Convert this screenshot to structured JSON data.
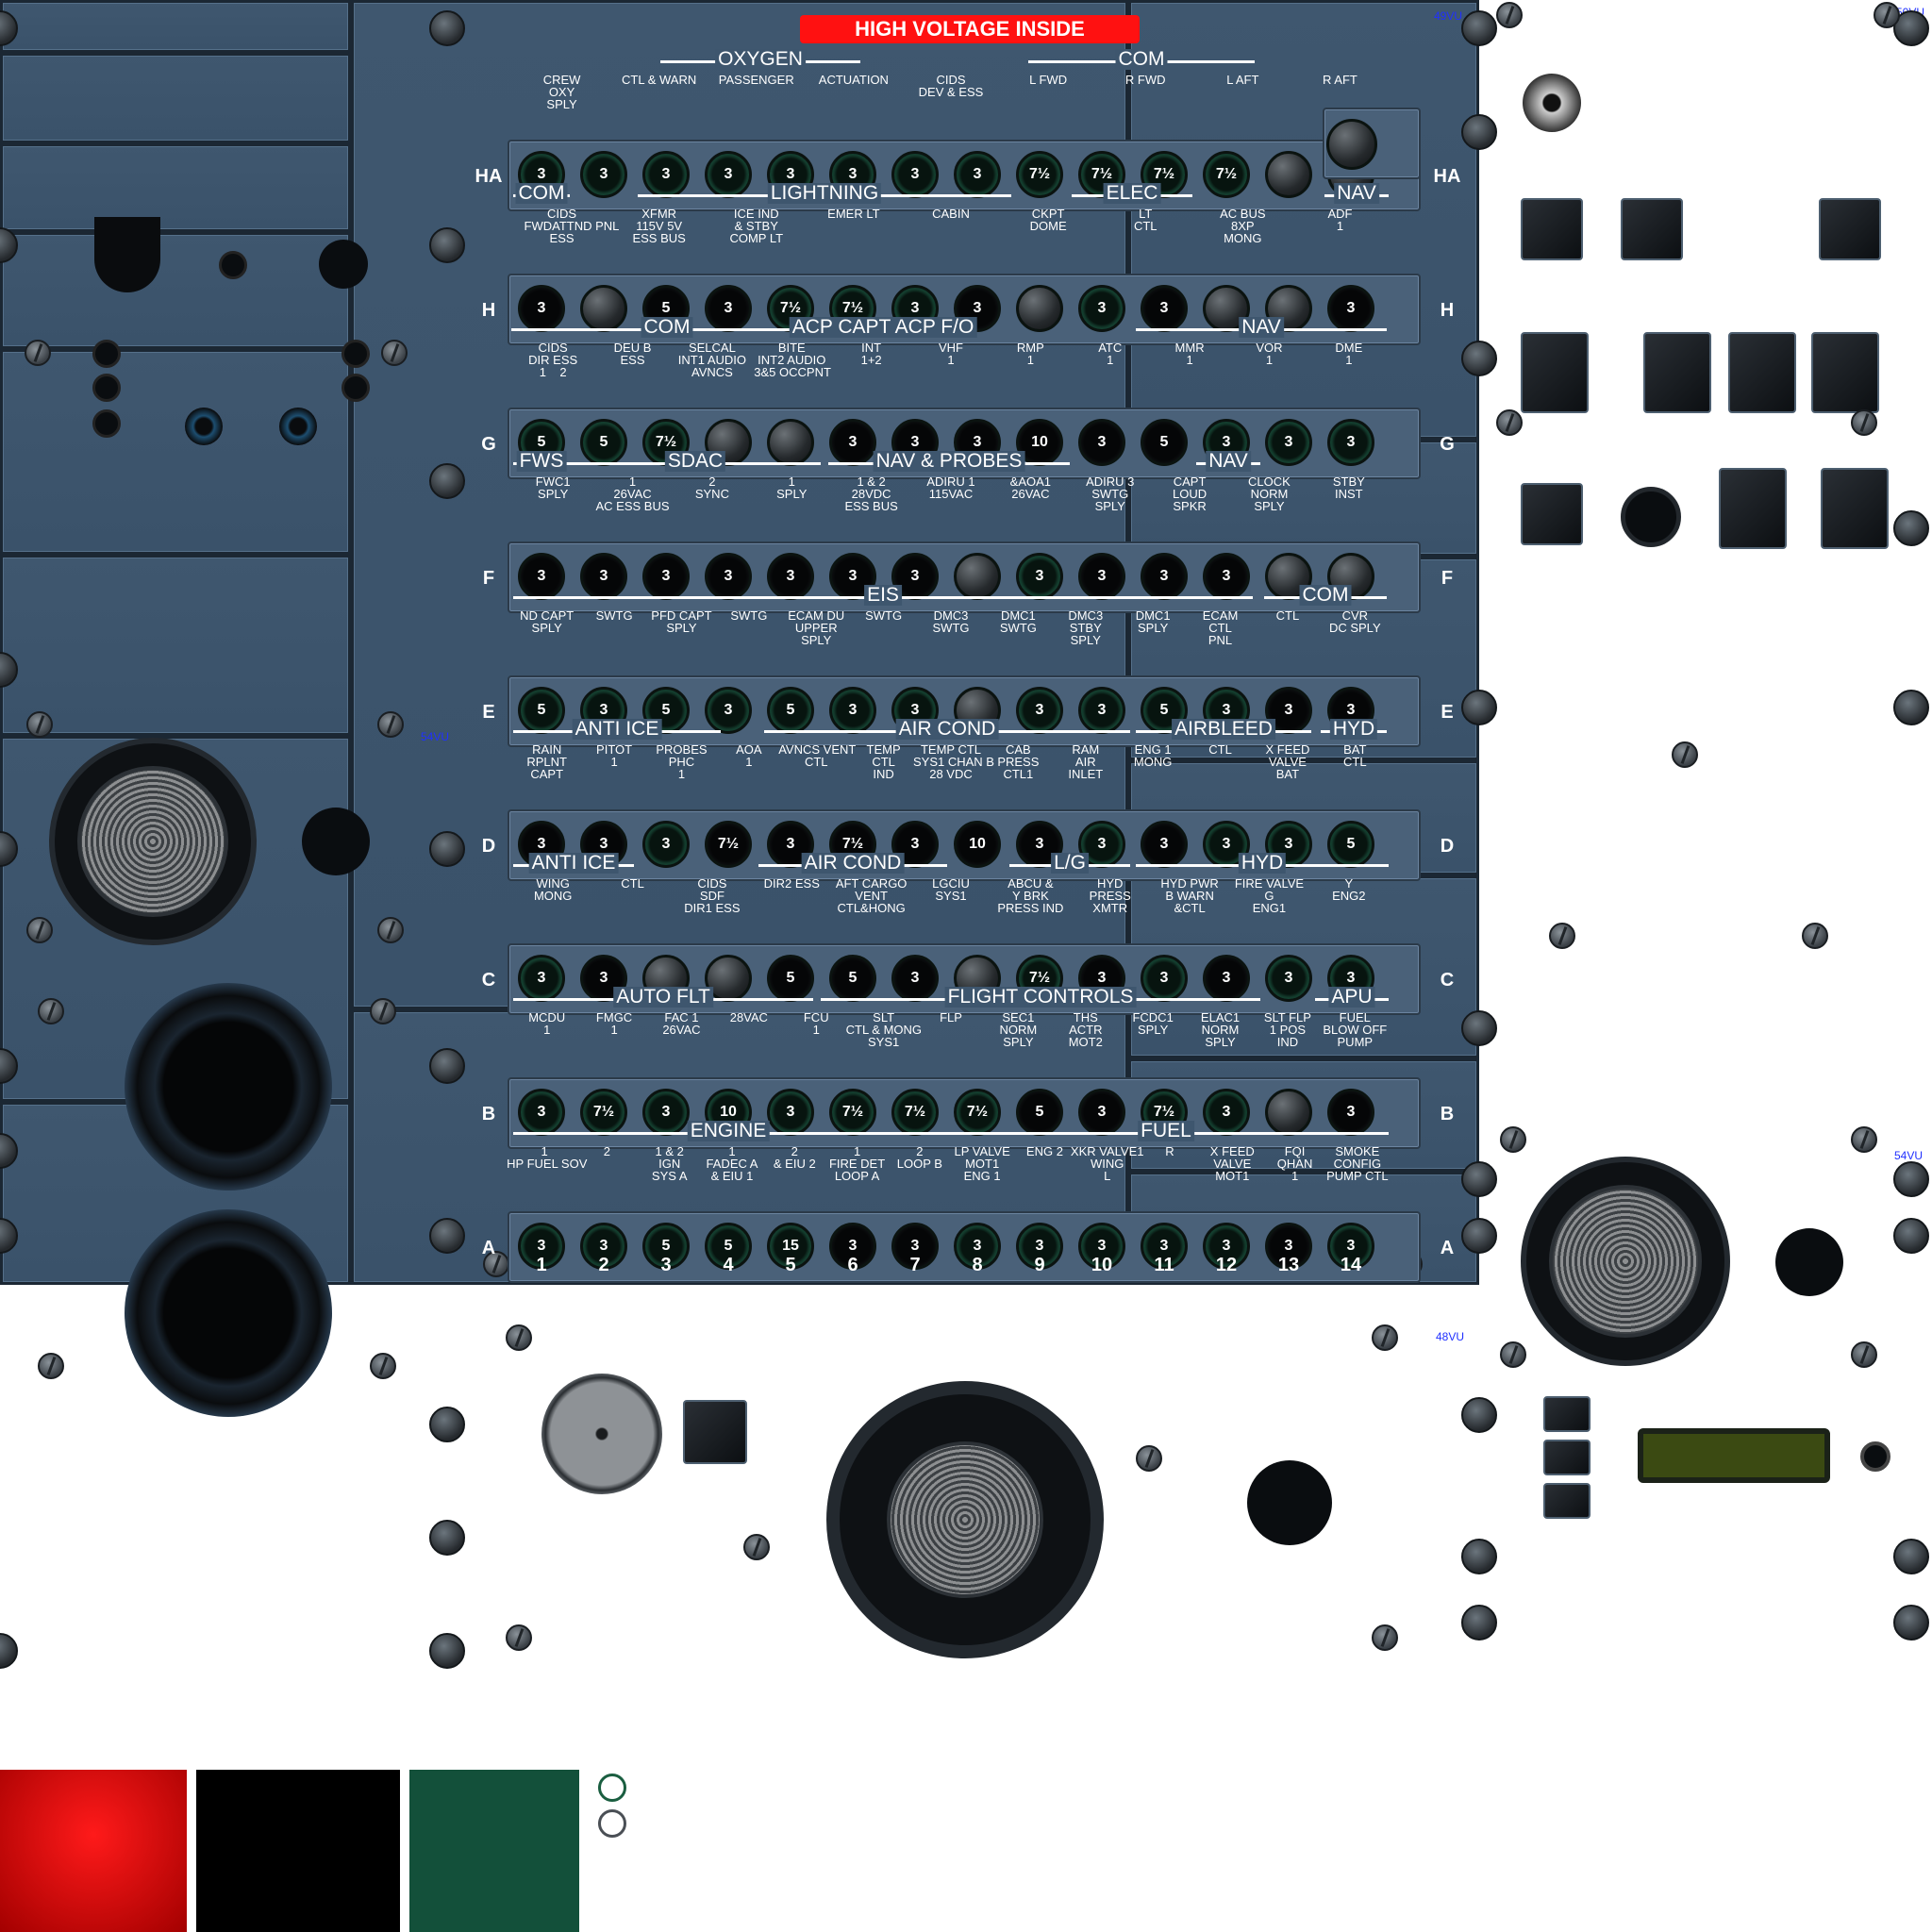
{
  "header": {
    "warning_label": "HIGH VOLTAGE INSIDE",
    "vu_top": "49VU",
    "vu_right": "50VU",
    "vu_left": "54VU",
    "vu_right2": "54VU",
    "vu_bottom": "48VU"
  },
  "rows": [
    "HA",
    "H",
    "G",
    "F",
    "E",
    "D",
    "C",
    "B",
    "A"
  ],
  "columns": [
    "1",
    "2",
    "3",
    "4",
    "5",
    "6",
    "7",
    "8",
    "9",
    "10",
    "11",
    "12",
    "13",
    "14"
  ],
  "breakers": {
    "HA": [
      "3",
      "3",
      "3",
      "3",
      "3",
      "3",
      "3",
      "3",
      "7½",
      "7½",
      "7½",
      "7½",
      "",
      ""
    ],
    "H": [
      "3",
      "",
      "5",
      "3",
      "7½",
      "7½",
      "3",
      "3",
      "",
      "3",
      "3",
      "",
      "",
      "3"
    ],
    "G": [
      "5",
      "5",
      "7½",
      "",
      "",
      "3",
      "3",
      "3",
      "10",
      "3",
      "5",
      "3",
      "3",
      "3"
    ],
    "F": [
      "3",
      "3",
      "3",
      "3",
      "3",
      "3",
      "3",
      "",
      "3",
      "3",
      "3",
      "3",
      "",
      ""
    ],
    "E": [
      "5",
      "3",
      "5",
      "3",
      "5",
      "3",
      "3",
      "",
      "3",
      "3",
      "5",
      "3",
      "3",
      "3"
    ],
    "D": [
      "3",
      "3",
      "3",
      "7½",
      "3",
      "7½",
      "3",
      "10",
      "3",
      "3",
      "3",
      "3",
      "3",
      "5"
    ],
    "C": [
      "3",
      "3",
      "",
      "",
      "5",
      "5",
      "3",
      "",
      "7½",
      "3",
      "3",
      "3",
      "3",
      "3"
    ],
    "B": [
      "3",
      "7½",
      "3",
      "10",
      "3",
      "7½",
      "7½",
      "7½",
      "5",
      "3",
      "7½",
      "3",
      "",
      "3"
    ],
    "A": [
      "3",
      "3",
      "5",
      "5",
      "15",
      "3",
      "3",
      "3",
      "3",
      "3",
      "3",
      "3",
      "3",
      "3"
    ]
  },
  "groups": [
    {
      "text": "OXYGEN",
      "row": "HA"
    },
    {
      "text": "COM",
      "row": "HA"
    },
    {
      "text": "COM",
      "row": "H"
    },
    {
      "text": "LIGHTNING",
      "row": "H"
    },
    {
      "text": "ELEC",
      "row": "H"
    },
    {
      "text": "NAV",
      "row": "H"
    },
    {
      "text": "COM",
      "row": "G"
    },
    {
      "text": "ACP CAPT ACP F/O",
      "row": "G"
    },
    {
      "text": "NAV",
      "row": "G"
    },
    {
      "text": "FWS",
      "row": "F"
    },
    {
      "text": "SDAC",
      "row": "F"
    },
    {
      "text": "NAV & PROBES",
      "row": "F"
    },
    {
      "text": "NAV",
      "row": "F"
    },
    {
      "text": "EIS",
      "row": "E"
    },
    {
      "text": "COM",
      "row": "E"
    },
    {
      "text": "ANTI ICE",
      "row": "D"
    },
    {
      "text": "AIR COND",
      "row": "D"
    },
    {
      "text": "AIRBLEED",
      "row": "D"
    },
    {
      "text": "HYD",
      "row": "D"
    },
    {
      "text": "ANTI ICE",
      "row": "C"
    },
    {
      "text": "AIR COND",
      "row": "C"
    },
    {
      "text": "L/G",
      "row": "C"
    },
    {
      "text": "HYD",
      "row": "C"
    },
    {
      "text": "AUTO FLT",
      "row": "B"
    },
    {
      "text": "FLIGHT CONTROLS",
      "row": "B"
    },
    {
      "text": "APU",
      "row": "B"
    },
    {
      "text": "ENGINE",
      "row": "A"
    },
    {
      "text": "FUEL",
      "row": "A"
    }
  ],
  "labels": {
    "HA": [
      "CREW\nOXY\nSPLY",
      "CTL & WARN",
      "PASSENGER",
      "ACTUATION",
      "CIDS\nDEV & ESS",
      "L FWD",
      "R FWD",
      "L AFT",
      "R AFT"
    ],
    "H": [
      "CIDS\nFWDATTND PNL\nESS",
      "XFMR\n115V 5V\nESS BUS",
      "ICE IND\n& STBY\nCOMP LT",
      "EMER LT",
      "CABIN",
      "CKPT\nDOME",
      "LT\nCTL",
      "AC BUS\n8XP\nMONG",
      "ADF\n1"
    ],
    "G": [
      "CIDS\nDIR ESS\n1    2",
      "DEU B\nESS",
      "SELCAL\nINT1 AUDIO\nAVNCS",
      "BITE\nINT2 AUDIO\n3&5 OCCPNT",
      "INT\n1+2",
      "VHF\n1",
      "RMP\n1",
      "ATC\n1",
      "MMR\n1",
      "VOR\n1",
      "DME\n1"
    ],
    "F": [
      "FWC1\nSPLY",
      "1\n26VAC\nAC ESS BUS",
      "2\nSYNC",
      "1\nSPLY",
      "1 & 2\n28VDC\nESS BUS",
      "ADIRU 1\n115VAC",
      "&AOA1\n26VAC",
      "ADIRU 3\nSWTG\nSPLY",
      "CAPT\nLOUD\nSPKR",
      "CLOCK\nNORM\nSPLY",
      "STBY\nINST"
    ],
    "E": [
      "ND CAPT\nSPLY",
      "SWTG",
      "PFD CAPT\nSPLY",
      "SWTG",
      "ECAM DU\nUPPER\nSPLY",
      "SWTG",
      "DMC3\nSWTG",
      "DMC1\nSWTG",
      "DMC3\nSTBY\nSPLY",
      "DMC1\nSPLY",
      "ECAM\nCTL\nPNL",
      "CTL",
      "CVR\nDC SPLY"
    ],
    "D": [
      "RAIN\nRPLNT\nCAPT",
      "PITOT\n1",
      "PROBES\nPHC\n1",
      "AOA\n1",
      "AVNCS VENT\nCTL",
      "TEMP\nCTL\nIND",
      "TEMP CTL\nSYS1 CHAN B\n28 VDC",
      "CAB\nPRESS\nCTL1",
      "RAM\nAIR\nINLET",
      "ENG 1\nMONG",
      "CTL",
      "X FEED\nVALVE\nBAT",
      "BAT\nCTL"
    ],
    "C": [
      "WING\nMONG",
      "CTL",
      "CIDS\nSDF\nDIR1 ESS",
      "DIR2 ESS",
      "AFT CARGO\nVENT\nCTL&HONG",
      "LGCIU\nSYS1",
      "ABCU &\nY BRK\nPRESS IND",
      "HYD\nPRESS\nXMTR",
      "HYD PWR\nB WARN\n&CTL",
      "FIRE VALVE\nG\nENG1",
      "Y\nENG2"
    ],
    "B": [
      "MCDU\n1",
      "FMGC\n1",
      "FAC 1\n26VAC",
      "28VAC",
      "FCU\n1",
      "SLT\nCTL & MONG\nSYS1",
      "FLP",
      "SEC1\nNORM\nSPLY",
      "THS\nACTR\nMOT2",
      "FCDC1\nSPLY",
      "ELAC1\nNORM\nSPLY",
      "SLT FLP\n1 POS\nIND",
      "FUEL\nBLOW OFF\nPUMP"
    ],
    "A": [
      "1\nHP FUEL SOV",
      "2",
      "1 & 2\nIGN\nSYS A",
      "1\nFADEC A\n& EIU 1",
      "2\n& EIU 2",
      "1\nFIRE DET\nLOOP A",
      "2\nLOOP B",
      "LP VALVE\nMOT1\nENG 1",
      "ENG 2",
      "XKR VALVE1\nWING\nL",
      "R",
      "X FEED\nVALVE\nMOT1",
      "FQI\nQHAN\n1",
      "SMOKE\nCONFIG\nPUMP CTL"
    ]
  },
  "legend": {
    "colors": [
      "#ff0000",
      "#000000",
      "#13503a"
    ],
    "ring_colors": [
      "#1a5e40",
      "#4a4f55"
    ]
  }
}
